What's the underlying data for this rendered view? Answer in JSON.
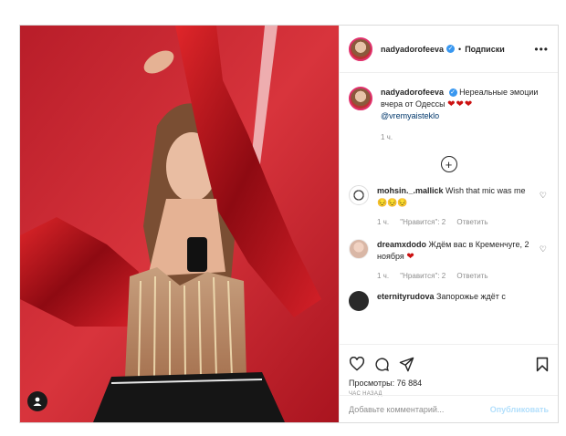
{
  "header": {
    "username": "nadyadorofeeva",
    "separator": "•",
    "follow_label": "Подписки",
    "more_label": "•••"
  },
  "caption": {
    "username": "nadyadorofeeva",
    "text": "Нереальные эмоции вчера от Одессы",
    "hearts": "❤❤❤",
    "mention": "@vremyaisteklo",
    "time": "1 ч."
  },
  "load_more_label": "+",
  "comments": [
    {
      "username": "mohsin._.mallick",
      "text": "Wish that mic was me",
      "emoji": "😔😔😔",
      "time": "1 ч.",
      "likes": "\"Нравится\": 2",
      "reply": "Ответить"
    },
    {
      "username": "dreamxdodo",
      "text": "Ждём вас в Кременчуге, 2 ноября",
      "emoji": "❤",
      "time": "1 ч.",
      "likes": "\"Нравится\": 2",
      "reply": "Ответить"
    },
    {
      "username": "eternityrudova",
      "text": "Запорожье ждёт с"
    }
  ],
  "stats": {
    "views": "Просмотры: 76 884",
    "posted_ago": "ЧАС НАЗАД"
  },
  "add_comment": {
    "placeholder": "Добавьте комментарий...",
    "publish_label": "Опубликовать"
  },
  "colors": {
    "stage_red": "#c4222c",
    "verified_blue": "#3897f0",
    "publish_disabled": "#b2dffc"
  }
}
